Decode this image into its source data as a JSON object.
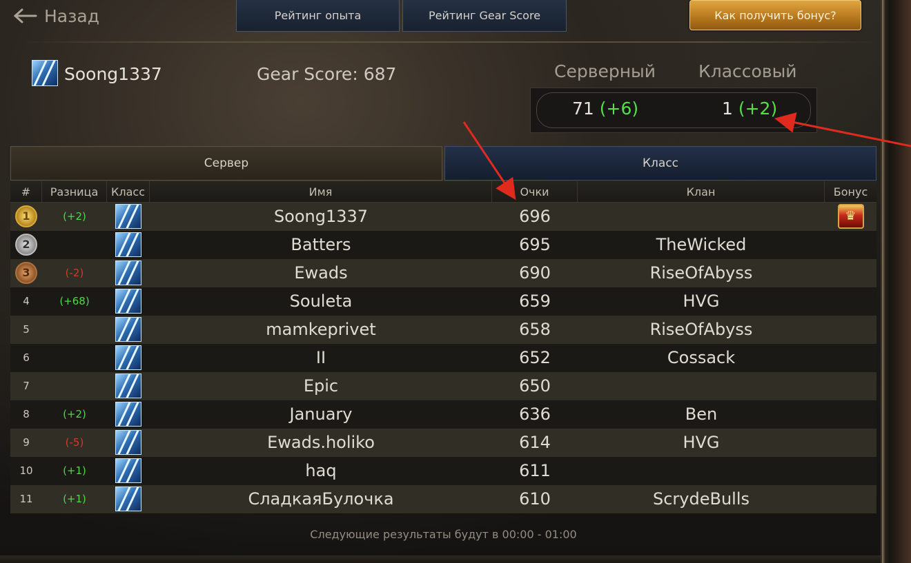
{
  "nav": {
    "back_label": "Назад",
    "tab_exp": "Рейтинг опыта",
    "tab_gs": "Рейтинг Gear Score",
    "bonus_button": "Как получить бонус?"
  },
  "player": {
    "name": "Soong1337",
    "gear_score_label": "Gear Score: 687",
    "server_label": "Серверный",
    "class_label": "Классовый",
    "server_rank": "71",
    "server_rank_delta": "(+6)",
    "class_rank": "1",
    "class_rank_delta": "(+2)"
  },
  "tabs": {
    "server": "Сервер",
    "class": "Класс"
  },
  "table": {
    "headers": {
      "num": "#",
      "diff": "Разница",
      "class": "Класс",
      "name": "Имя",
      "points": "Очки",
      "clan": "Клан",
      "bonus": "Бонус"
    },
    "rows": [
      {
        "num": "1",
        "diff": "(+2)",
        "name": "Soong1337",
        "points": "696",
        "clan": ""
      },
      {
        "num": "2",
        "diff": "",
        "name": "Batters",
        "points": "695",
        "clan": "TheWicked"
      },
      {
        "num": "3",
        "diff": "(-2)",
        "name": "Ewads",
        "points": "690",
        "clan": "RiseOfAbyss"
      },
      {
        "num": "4",
        "diff": "(+68)",
        "name": "Souleta",
        "points": "659",
        "clan": "HVG"
      },
      {
        "num": "5",
        "diff": "",
        "name": "mamkeprivet",
        "points": "658",
        "clan": "RiseOfAbyss"
      },
      {
        "num": "6",
        "diff": "",
        "name": "II",
        "points": "652",
        "clan": "Cossack"
      },
      {
        "num": "7",
        "diff": "",
        "name": "Epic",
        "points": "650",
        "clan": ""
      },
      {
        "num": "8",
        "diff": "(+2)",
        "name": "January",
        "points": "636",
        "clan": "Ben"
      },
      {
        "num": "9",
        "diff": "(-5)",
        "name": "Ewads.holiko",
        "points": "614",
        "clan": "HVG"
      },
      {
        "num": "10",
        "diff": "(+1)",
        "name": "haq",
        "points": "611",
        "clan": ""
      },
      {
        "num": "11",
        "diff": "(+1)",
        "name": "СладкаяБулочка",
        "points": "610",
        "clan": "ScrydeBulls"
      }
    ]
  },
  "footer": {
    "note": "Следующие результаты будут в 00:00 - 01:00"
  },
  "colors": {
    "positive": "#4fd84a",
    "negative": "#d23a2a",
    "annotation_arrow": "#e02a1e"
  }
}
